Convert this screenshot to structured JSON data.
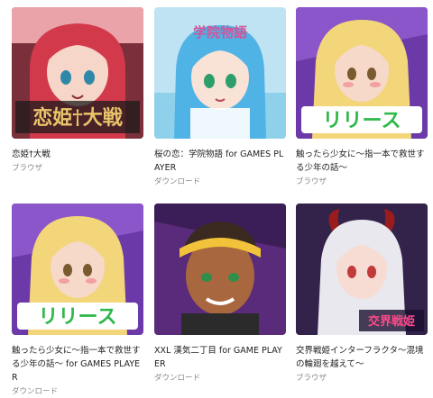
{
  "games": [
    {
      "title": "恋姫†大戦",
      "type": "ブラウザ",
      "overlay": "恋姫†大戦",
      "colors": {
        "bg": "#7b2f3a",
        "hair": "#d23a4c",
        "skin": "#f6d6c8"
      }
    },
    {
      "title": "桜の恋：学院物語 for GAMES PLAYER",
      "type": "ダウンロード",
      "overlay": "学院物語",
      "colors": {
        "bg": "#bfe3f3",
        "hair": "#4fb3e6",
        "skin": "#f9e2d6"
      }
    },
    {
      "title": "触ったら少女に～指一本で救世する少年の話～",
      "type": "ブラウザ",
      "overlay": "リリース",
      "colors": {
        "bg": "#6c3aa8",
        "hair": "#f3d57a",
        "skin": "#f6d9c9"
      }
    },
    {
      "title": "触ったら少女に～指一本で救世する少年の話～ for GAMES PLAYER",
      "type": "ダウンロード",
      "overlay": "リリース",
      "colors": {
        "bg": "#6c3aa8",
        "hair": "#f3d57a",
        "skin": "#f6d9c9"
      }
    },
    {
      "title": "XXL 漢気二丁目 for GAME PLAYER",
      "type": "ダウンロード",
      "overlay": "",
      "colors": {
        "bg": "#5a2b7a",
        "hair": "#3a2a1f",
        "skin": "#a8673e"
      }
    },
    {
      "title": "交界戦姫インターフラクタ～混境の輪廻を越えて～",
      "type": "ブラウザ",
      "overlay": "交界戦姫",
      "colors": {
        "bg": "#2a1f3a",
        "hair": "#e8e8ee",
        "skin": "#f6dcd3"
      }
    }
  ]
}
